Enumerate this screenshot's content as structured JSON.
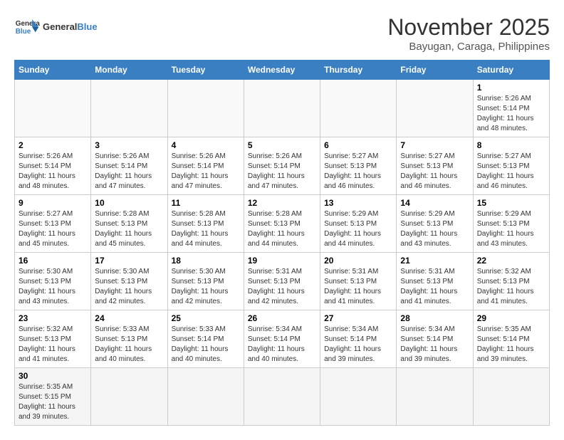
{
  "header": {
    "logo_general": "General",
    "logo_blue": "Blue",
    "month_title": "November 2025",
    "location": "Bayugan, Caraga, Philippines"
  },
  "weekdays": [
    "Sunday",
    "Monday",
    "Tuesday",
    "Wednesday",
    "Thursday",
    "Friday",
    "Saturday"
  ],
  "weeks": [
    [
      {
        "day": "",
        "info": ""
      },
      {
        "day": "",
        "info": ""
      },
      {
        "day": "",
        "info": ""
      },
      {
        "day": "",
        "info": ""
      },
      {
        "day": "",
        "info": ""
      },
      {
        "day": "",
        "info": ""
      },
      {
        "day": "1",
        "info": "Sunrise: 5:26 AM\nSunset: 5:14 PM\nDaylight: 11 hours\nand 48 minutes."
      }
    ],
    [
      {
        "day": "2",
        "info": "Sunrise: 5:26 AM\nSunset: 5:14 PM\nDaylight: 11 hours\nand 48 minutes."
      },
      {
        "day": "3",
        "info": "Sunrise: 5:26 AM\nSunset: 5:14 PM\nDaylight: 11 hours\nand 47 minutes."
      },
      {
        "day": "4",
        "info": "Sunrise: 5:26 AM\nSunset: 5:14 PM\nDaylight: 11 hours\nand 47 minutes."
      },
      {
        "day": "5",
        "info": "Sunrise: 5:26 AM\nSunset: 5:14 PM\nDaylight: 11 hours\nand 47 minutes."
      },
      {
        "day": "6",
        "info": "Sunrise: 5:27 AM\nSunset: 5:13 PM\nDaylight: 11 hours\nand 46 minutes."
      },
      {
        "day": "7",
        "info": "Sunrise: 5:27 AM\nSunset: 5:13 PM\nDaylight: 11 hours\nand 46 minutes."
      },
      {
        "day": "8",
        "info": "Sunrise: 5:27 AM\nSunset: 5:13 PM\nDaylight: 11 hours\nand 46 minutes."
      }
    ],
    [
      {
        "day": "9",
        "info": "Sunrise: 5:27 AM\nSunset: 5:13 PM\nDaylight: 11 hours\nand 45 minutes."
      },
      {
        "day": "10",
        "info": "Sunrise: 5:28 AM\nSunset: 5:13 PM\nDaylight: 11 hours\nand 45 minutes."
      },
      {
        "day": "11",
        "info": "Sunrise: 5:28 AM\nSunset: 5:13 PM\nDaylight: 11 hours\nand 44 minutes."
      },
      {
        "day": "12",
        "info": "Sunrise: 5:28 AM\nSunset: 5:13 PM\nDaylight: 11 hours\nand 44 minutes."
      },
      {
        "day": "13",
        "info": "Sunrise: 5:29 AM\nSunset: 5:13 PM\nDaylight: 11 hours\nand 44 minutes."
      },
      {
        "day": "14",
        "info": "Sunrise: 5:29 AM\nSunset: 5:13 PM\nDaylight: 11 hours\nand 43 minutes."
      },
      {
        "day": "15",
        "info": "Sunrise: 5:29 AM\nSunset: 5:13 PM\nDaylight: 11 hours\nand 43 minutes."
      }
    ],
    [
      {
        "day": "16",
        "info": "Sunrise: 5:30 AM\nSunset: 5:13 PM\nDaylight: 11 hours\nand 43 minutes."
      },
      {
        "day": "17",
        "info": "Sunrise: 5:30 AM\nSunset: 5:13 PM\nDaylight: 11 hours\nand 42 minutes."
      },
      {
        "day": "18",
        "info": "Sunrise: 5:30 AM\nSunset: 5:13 PM\nDaylight: 11 hours\nand 42 minutes."
      },
      {
        "day": "19",
        "info": "Sunrise: 5:31 AM\nSunset: 5:13 PM\nDaylight: 11 hours\nand 42 minutes."
      },
      {
        "day": "20",
        "info": "Sunrise: 5:31 AM\nSunset: 5:13 PM\nDaylight: 11 hours\nand 41 minutes."
      },
      {
        "day": "21",
        "info": "Sunrise: 5:31 AM\nSunset: 5:13 PM\nDaylight: 11 hours\nand 41 minutes."
      },
      {
        "day": "22",
        "info": "Sunrise: 5:32 AM\nSunset: 5:13 PM\nDaylight: 11 hours\nand 41 minutes."
      }
    ],
    [
      {
        "day": "23",
        "info": "Sunrise: 5:32 AM\nSunset: 5:13 PM\nDaylight: 11 hours\nand 41 minutes."
      },
      {
        "day": "24",
        "info": "Sunrise: 5:33 AM\nSunset: 5:13 PM\nDaylight: 11 hours\nand 40 minutes."
      },
      {
        "day": "25",
        "info": "Sunrise: 5:33 AM\nSunset: 5:14 PM\nDaylight: 11 hours\nand 40 minutes."
      },
      {
        "day": "26",
        "info": "Sunrise: 5:34 AM\nSunset: 5:14 PM\nDaylight: 11 hours\nand 40 minutes."
      },
      {
        "day": "27",
        "info": "Sunrise: 5:34 AM\nSunset: 5:14 PM\nDaylight: 11 hours\nand 39 minutes."
      },
      {
        "day": "28",
        "info": "Sunrise: 5:34 AM\nSunset: 5:14 PM\nDaylight: 11 hours\nand 39 minutes."
      },
      {
        "day": "29",
        "info": "Sunrise: 5:35 AM\nSunset: 5:14 PM\nDaylight: 11 hours\nand 39 minutes."
      }
    ],
    [
      {
        "day": "30",
        "info": "Sunrise: 5:35 AM\nSunset: 5:15 PM\nDaylight: 11 hours\nand 39 minutes."
      },
      {
        "day": "",
        "info": ""
      },
      {
        "day": "",
        "info": ""
      },
      {
        "day": "",
        "info": ""
      },
      {
        "day": "",
        "info": ""
      },
      {
        "day": "",
        "info": ""
      },
      {
        "day": "",
        "info": ""
      }
    ]
  ]
}
